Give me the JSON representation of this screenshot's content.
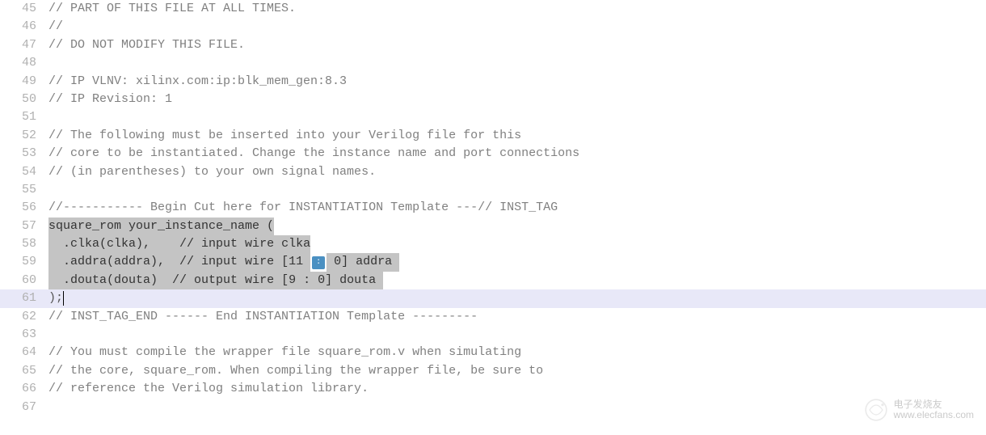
{
  "lines": [
    {
      "num": "45",
      "text": "// PART OF THIS FILE AT ALL TIMES.",
      "type": "comment"
    },
    {
      "num": "46",
      "text": "//",
      "type": "comment"
    },
    {
      "num": "47",
      "text": "// DO NOT MODIFY THIS FILE.",
      "type": "comment"
    },
    {
      "num": "48",
      "text": "",
      "type": "blank"
    },
    {
      "num": "49",
      "text": "// IP VLNV: xilinx.com:ip:blk_mem_gen:8.3",
      "type": "comment"
    },
    {
      "num": "50",
      "text": "// IP Revision: 1",
      "type": "comment"
    },
    {
      "num": "51",
      "text": "",
      "type": "blank"
    },
    {
      "num": "52",
      "text": "// The following must be inserted into your Verilog file for this",
      "type": "comment"
    },
    {
      "num": "53",
      "text": "// core to be instantiated. Change the instance name and port connections",
      "type": "comment"
    },
    {
      "num": "54",
      "text": "// (in parentheses) to your own signal names.",
      "type": "comment"
    },
    {
      "num": "55",
      "text": "",
      "type": "blank"
    },
    {
      "num": "56",
      "text": "//----------- Begin Cut here for INSTANTIATION Template ---// INST_TAG",
      "type": "comment"
    },
    {
      "num": "57",
      "sel": "square_rom your_instance_name (",
      "after": "",
      "type": "selected"
    },
    {
      "num": "58",
      "indent": "  ",
      "sel": ".clka(clka),    ",
      "mid": "// input wire clka",
      "type": "selected-split"
    },
    {
      "num": "59",
      "indent": "  ",
      "sel": ".addra(addra),  ",
      "mid1": "// input wire [11 ",
      "mid2": " 0] addra ",
      "type": "selected-icon"
    },
    {
      "num": "60",
      "indent": "  ",
      "sel": ".douta(douta)  ",
      "mid": "// output wire [9 : 0] douta ",
      "type": "selected-split2"
    },
    {
      "num": "61",
      "text": ");",
      "type": "highlight"
    },
    {
      "num": "62",
      "text": "// INST_TAG_END ------ End INSTANTIATION Template ---------",
      "type": "comment"
    },
    {
      "num": "63",
      "text": "",
      "type": "blank"
    },
    {
      "num": "64",
      "text": "// You must compile the wrapper file square_rom.v when simulating",
      "type": "comment"
    },
    {
      "num": "65",
      "text": "// the core, square_rom. When compiling the wrapper file, be sure to",
      "type": "comment"
    },
    {
      "num": "66",
      "text": "// reference the Verilog simulation library.",
      "type": "comment"
    },
    {
      "num": "67",
      "text": "",
      "type": "blank"
    }
  ],
  "icon_label": "▯",
  "watermark": {
    "cn": "电子发烧友",
    "url": "www.elecfans.com"
  }
}
